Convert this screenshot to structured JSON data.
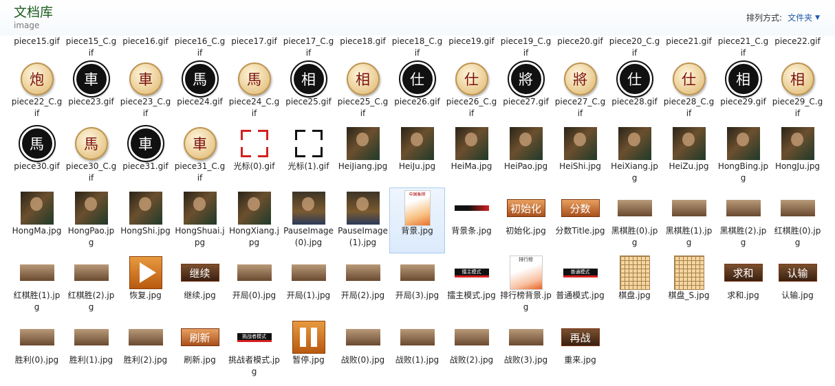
{
  "header": {
    "title": "文档库",
    "subtitle": "image",
    "arrange_label": "排列方式:",
    "arrange_value": "文件夹"
  },
  "rows": [
    [
      {
        "label": "piece15.gif",
        "icon": "gif-thumbnail"
      },
      {
        "label": "piece15_C.gif",
        "icon": "gif-thumbnail"
      },
      {
        "label": "piece16.gif",
        "icon": "gif-thumbnail"
      },
      {
        "label": "piece16_C.gif",
        "icon": "gif-thumbnail"
      },
      {
        "label": "piece17.gif",
        "icon": "gif-thumbnail"
      },
      {
        "label": "piece17_C.gif",
        "icon": "gif-thumbnail"
      },
      {
        "label": "piece18.gif",
        "icon": "gif-thumbnail"
      },
      {
        "label": "piece18_C.gif",
        "icon": "gif-thumbnail"
      },
      {
        "label": "piece19.gif",
        "icon": "gif-thumbnail"
      },
      {
        "label": "piece19_C.gif",
        "icon": "gif-thumbnail"
      },
      {
        "label": "piece20.gif",
        "icon": "gif-thumbnail"
      },
      {
        "label": "piece20_C.gif",
        "icon": "gif-thumbnail"
      },
      {
        "label": "piece21.gif",
        "icon": "gif-thumbnail"
      },
      {
        "label": "piece21_C.gif",
        "icon": "gif-thumbnail"
      },
      {
        "label": "piece22.gif",
        "icon": "gif-thumbnail"
      }
    ],
    [
      {
        "label": "piece22_C.gif",
        "kind": "piece",
        "style": "red",
        "glyph": "炮"
      },
      {
        "label": "piece23.gif",
        "kind": "piece",
        "style": "blk",
        "glyph": "車"
      },
      {
        "label": "piece23_C.gif",
        "kind": "piece",
        "style": "red",
        "glyph": "車"
      },
      {
        "label": "piece24.gif",
        "kind": "piece",
        "style": "blk",
        "glyph": "馬"
      },
      {
        "label": "piece24_C.gif",
        "kind": "piece",
        "style": "red",
        "glyph": "馬"
      },
      {
        "label": "piece25.gif",
        "kind": "piece",
        "style": "blk",
        "glyph": "相"
      },
      {
        "label": "piece25_C.gif",
        "kind": "piece",
        "style": "red",
        "glyph": "相"
      },
      {
        "label": "piece26.gif",
        "kind": "piece",
        "style": "blk",
        "glyph": "仕"
      },
      {
        "label": "piece26_C.gif",
        "kind": "piece",
        "style": "red",
        "glyph": "仕"
      },
      {
        "label": "piece27.gif",
        "kind": "piece",
        "style": "blk",
        "glyph": "將"
      },
      {
        "label": "piece27_C.gif",
        "kind": "piece",
        "style": "red",
        "glyph": "將"
      },
      {
        "label": "piece28.gif",
        "kind": "piece",
        "style": "blk",
        "glyph": "仕"
      },
      {
        "label": "piece28_C.gif",
        "kind": "piece",
        "style": "red",
        "glyph": "仕"
      },
      {
        "label": "piece29.gif",
        "kind": "piece",
        "style": "blk",
        "glyph": "相"
      },
      {
        "label": "piece29_C.gif",
        "kind": "piece",
        "style": "red",
        "glyph": "相"
      }
    ],
    [
      {
        "label": "piece30.gif",
        "kind": "piece",
        "style": "blk",
        "glyph": "馬"
      },
      {
        "label": "piece30_C.gif",
        "kind": "piece",
        "style": "red",
        "glyph": "馬"
      },
      {
        "label": "piece31.gif",
        "kind": "piece",
        "style": "blk",
        "glyph": "車"
      },
      {
        "label": "piece31_C.gif",
        "kind": "piece",
        "style": "red",
        "glyph": "車"
      },
      {
        "label": "光标(0).gif",
        "kind": "cursor",
        "style": "red"
      },
      {
        "label": "光标(1).gif",
        "kind": "cursor",
        "style": "blk"
      },
      {
        "label": "HeiJiang.jpg",
        "kind": "photo"
      },
      {
        "label": "HeiJu.jpg",
        "kind": "photo"
      },
      {
        "label": "HeiMa.jpg",
        "kind": "photo"
      },
      {
        "label": "HeiPao.jpg",
        "kind": "photo"
      },
      {
        "label": "HeiShi.jpg",
        "kind": "photo"
      },
      {
        "label": "HeiXiang.jpg",
        "kind": "photo"
      },
      {
        "label": "HeiZu.jpg",
        "kind": "photo"
      },
      {
        "label": "HongBing.jpg",
        "kind": "photo"
      },
      {
        "label": "HongJu.jpg",
        "kind": "photo"
      }
    ],
    [
      {
        "label": "HongMa.jpg",
        "kind": "photo"
      },
      {
        "label": "HongPao.jpg",
        "kind": "photo"
      },
      {
        "label": "HongShi.jpg",
        "kind": "photo"
      },
      {
        "label": "HongShuai.jpg",
        "kind": "photo"
      },
      {
        "label": "HongXiang.jpg",
        "kind": "photo"
      },
      {
        "label": "PauseImage(0).jpg",
        "kind": "port"
      },
      {
        "label": "PauseImage(1).jpg",
        "kind": "port"
      },
      {
        "label": "背景.jpg",
        "kind": "bg",
        "selected": true,
        "text": "中国象棋"
      },
      {
        "label": "背景条.jpg",
        "kind": "bar"
      },
      {
        "label": "初始化.jpg",
        "kind": "btn",
        "text": "初始化"
      },
      {
        "label": "分数Title.jpg",
        "kind": "btn",
        "text": "分数"
      },
      {
        "label": "黑棋胜(0).jpg",
        "kind": "banner"
      },
      {
        "label": "黑棋胜(1).jpg",
        "kind": "banner"
      },
      {
        "label": "黑棋胜(2).jpg",
        "kind": "banner"
      },
      {
        "label": "红棋胜(0).jpg",
        "kind": "banner"
      }
    ],
    [
      {
        "label": "红棋胜(1).jpg",
        "kind": "banner"
      },
      {
        "label": "红棋胜(2).jpg",
        "kind": "banner"
      },
      {
        "label": "恢复.jpg",
        "kind": "play"
      },
      {
        "label": "继续.jpg",
        "kind": "btnd",
        "text": "继续"
      },
      {
        "label": "开局(0).jpg",
        "kind": "banner"
      },
      {
        "label": "开局(1).jpg",
        "kind": "banner"
      },
      {
        "label": "开局(2).jpg",
        "kind": "banner"
      },
      {
        "label": "开局(3).jpg",
        "kind": "banner"
      },
      {
        "label": "擂主模式.jpg",
        "kind": "bar2",
        "text": "擂主模式"
      },
      {
        "label": "排行榜背景.jpg",
        "kind": "rank",
        "text": "排行榜"
      },
      {
        "label": "普通模式.jpg",
        "kind": "bar2",
        "text": "普通模式"
      },
      {
        "label": "棋盘.jpg",
        "kind": "board"
      },
      {
        "label": "棋盘_S.jpg",
        "kind": "board"
      },
      {
        "label": "求和.jpg",
        "kind": "btnd",
        "text": "求和"
      },
      {
        "label": "认输.jpg",
        "kind": "btnd",
        "text": "认输"
      }
    ],
    [
      {
        "label": "胜利(0).jpg",
        "kind": "banner"
      },
      {
        "label": "胜利(1).jpg",
        "kind": "banner"
      },
      {
        "label": "胜利(2).jpg",
        "kind": "banner"
      },
      {
        "label": "刷新.jpg",
        "kind": "btn",
        "text": "刷新"
      },
      {
        "label": "挑战者模式.jpg",
        "kind": "bar2",
        "text": "挑战者模式"
      },
      {
        "label": "暂停.jpg",
        "kind": "pause"
      },
      {
        "label": "战败(0).jpg",
        "kind": "banner"
      },
      {
        "label": "战败(1).jpg",
        "kind": "banner"
      },
      {
        "label": "战败(2).jpg",
        "kind": "banner"
      },
      {
        "label": "战败(3).jpg",
        "kind": "banner"
      },
      {
        "label": "重来.jpg",
        "kind": "btnd",
        "text": "再战"
      }
    ]
  ]
}
